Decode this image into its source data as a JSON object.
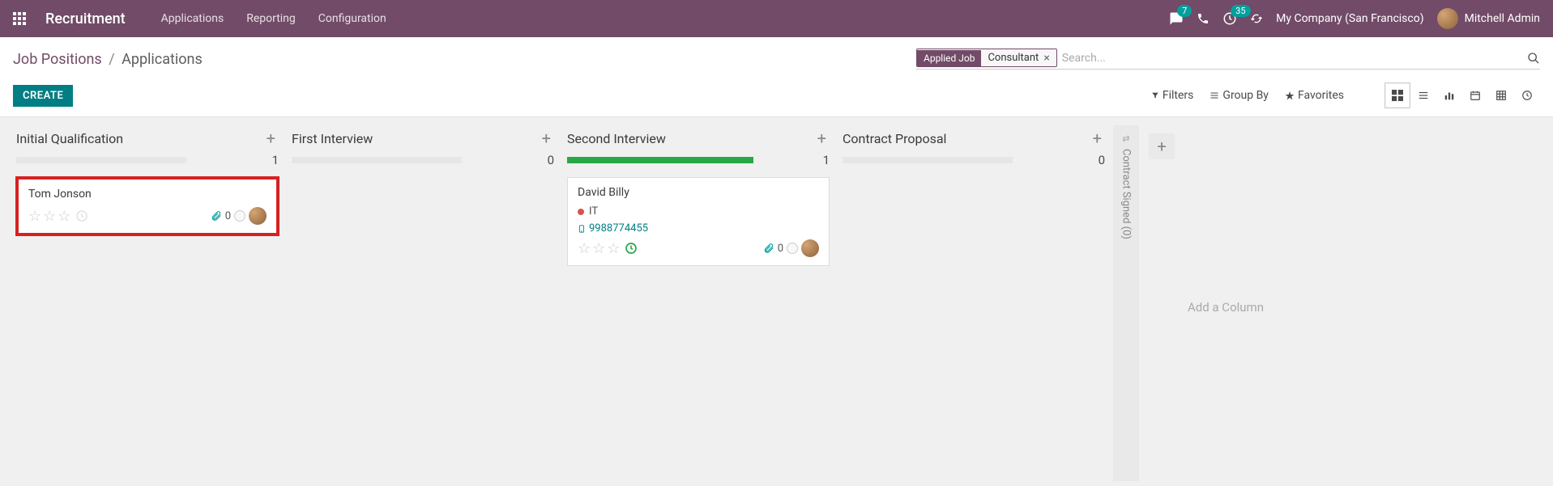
{
  "navbar": {
    "brand": "Recruitment",
    "links": [
      "Applications",
      "Reporting",
      "Configuration"
    ],
    "chat_badge": "7",
    "activities_badge": "35",
    "company": "My Company (San Francisco)",
    "user": "Mitchell Admin"
  },
  "breadcrumb": {
    "root": "Job Positions",
    "current": "Applications"
  },
  "search": {
    "facet_label": "Applied Job",
    "facet_value": "Consultant",
    "placeholder": "Search..."
  },
  "buttons": {
    "create": "CREATE",
    "filters": "Filters",
    "group_by": "Group By",
    "favorites": "Favorites"
  },
  "columns": [
    {
      "title": "Initial Qualification",
      "count": "1",
      "bar_green": false,
      "cards": [
        {
          "name": "Tom Jonson",
          "highlighted": true,
          "tags": [],
          "phone": "",
          "attachments": "0",
          "clock_active": false
        }
      ]
    },
    {
      "title": "First Interview",
      "count": "0",
      "bar_green": false,
      "cards": []
    },
    {
      "title": "Second Interview",
      "count": "1",
      "bar_green": true,
      "cards": [
        {
          "name": "David Billy",
          "highlighted": false,
          "tags": [
            "IT"
          ],
          "phone": "9988774455",
          "attachments": "0",
          "clock_active": true
        }
      ]
    },
    {
      "title": "Contract Proposal",
      "count": "0",
      "bar_green": false,
      "cards": []
    }
  ],
  "folded_column": "Contract Signed (0)",
  "add_column": "Add a Column"
}
